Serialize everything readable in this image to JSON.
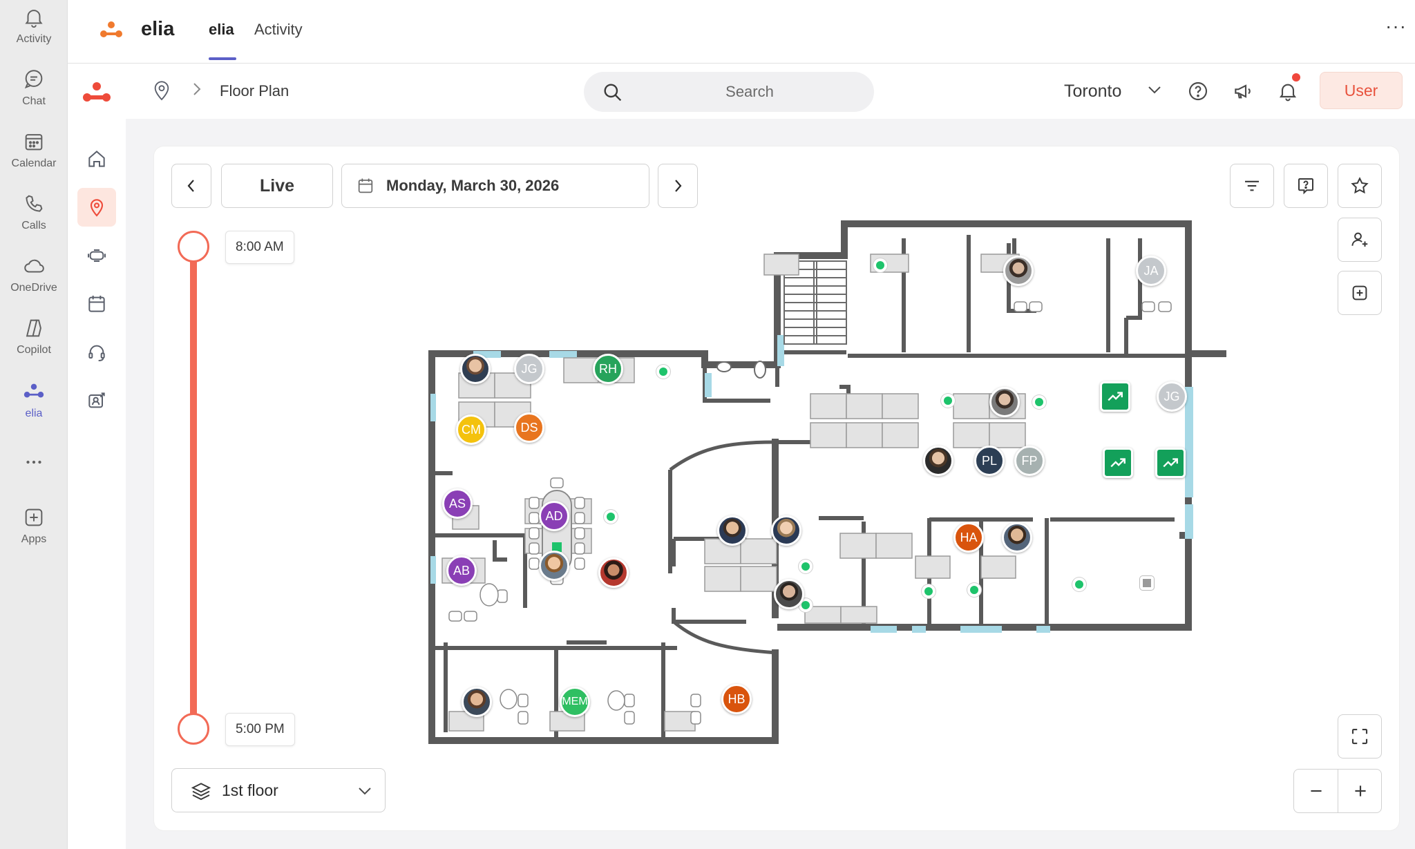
{
  "teams_rail": {
    "items": [
      {
        "label": "Activity",
        "icon": "bell-icon"
      },
      {
        "label": "Chat",
        "icon": "chat-icon"
      },
      {
        "label": "Calendar",
        "icon": "calendar-icon"
      },
      {
        "label": "Calls",
        "icon": "phone-icon"
      },
      {
        "label": "OneDrive",
        "icon": "cloud-icon"
      },
      {
        "label": "Copilot",
        "icon": "copilot-icon"
      },
      {
        "label": "elia",
        "icon": "elia-icon",
        "active": true
      },
      {
        "label": "",
        "icon": "more-icon"
      },
      {
        "label": "Apps",
        "icon": "add-app-icon"
      }
    ]
  },
  "header": {
    "app_name": "elia",
    "tabs": [
      {
        "label": "elia",
        "active": true
      },
      {
        "label": "Activity"
      }
    ],
    "more": "···"
  },
  "subheader": {
    "breadcrumb_title": "Floor Plan",
    "search_placeholder": "Search",
    "city": "Toronto",
    "user_label": "User"
  },
  "toolbar": {
    "live_label": "Live",
    "date_label": "Monday, March 30, 2026"
  },
  "timeline": {
    "start_label": "8:00 AM",
    "end_label": "5:00 PM"
  },
  "floor_selector": {
    "label": "1st floor"
  },
  "occupants": {
    "jg1": "JG",
    "rh": "RH",
    "cm": "CM",
    "ds": "DS",
    "as": "AS",
    "ab": "AB",
    "ad": "AD",
    "mem": "MEM",
    "hb": "HB",
    "ja": "JA",
    "jg2": "JG",
    "pl": "PL",
    "fp": "FP",
    "ha": "HA"
  },
  "colors": {
    "accent": "#f26a56",
    "teams_purple": "#5b5fc7",
    "available_green": "#1ec36b",
    "wall": "#5a5a5a"
  }
}
